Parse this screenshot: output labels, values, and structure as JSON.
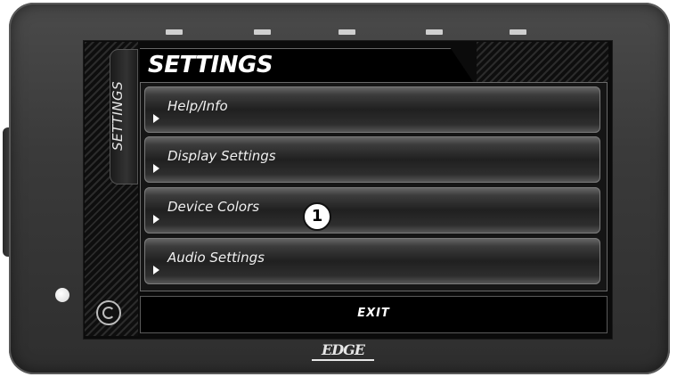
{
  "device": {
    "brand_logo": "EDGE",
    "colors": {
      "bezel": "#3a3a3a",
      "screen": "#0b0b0b",
      "accent_text": "#ffffff"
    }
  },
  "sidebar": {
    "tab_label": "SETTINGS"
  },
  "header": {
    "title": "SETTINGS"
  },
  "menu": {
    "items": [
      {
        "label": "Help/Info"
      },
      {
        "label": "Display Settings"
      },
      {
        "label": "Device Colors"
      },
      {
        "label": "Audio Settings"
      }
    ]
  },
  "callout": {
    "number": "1"
  },
  "footer": {
    "exit_label": "EXIT"
  },
  "icons": {
    "back": "power-circle-icon",
    "row_indicator": "triangle-right-icon"
  }
}
